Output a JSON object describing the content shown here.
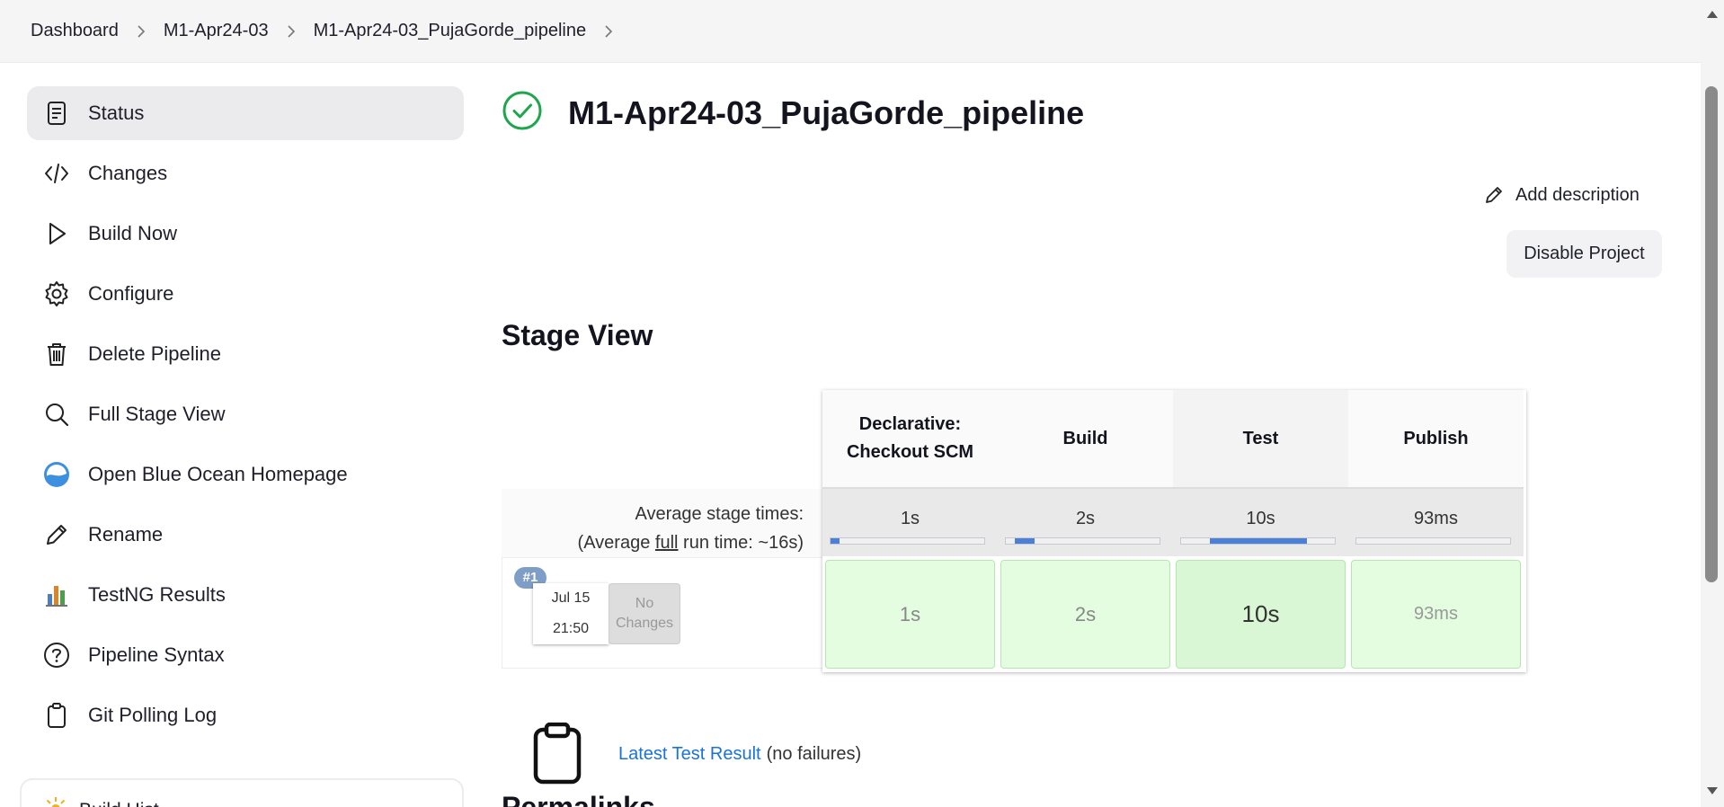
{
  "breadcrumb": {
    "items": [
      "Dashboard",
      "M1-Apr24-03",
      "M1-Apr24-03_PujaGorde_pipeline"
    ]
  },
  "sidebar": {
    "items": [
      {
        "label": "Status",
        "icon": "status-icon",
        "active": true
      },
      {
        "label": "Changes",
        "icon": "code-icon"
      },
      {
        "label": "Build Now",
        "icon": "play-icon"
      },
      {
        "label": "Configure",
        "icon": "gear-icon"
      },
      {
        "label": "Delete Pipeline",
        "icon": "trash-icon"
      },
      {
        "label": "Full Stage View",
        "icon": "search-icon"
      },
      {
        "label": "Open Blue Ocean Homepage",
        "icon": "blue-ocean-icon"
      },
      {
        "label": "Rename",
        "icon": "pencil-icon"
      },
      {
        "label": "TestNG Results",
        "icon": "chart-icon"
      },
      {
        "label": "Pipeline Syntax",
        "icon": "help-icon"
      },
      {
        "label": "Git Polling Log",
        "icon": "clipboard-icon"
      }
    ],
    "build_history": {
      "label": "Build Hist"
    }
  },
  "main": {
    "title": "M1-Apr24-03_PujaGorde_pipeline",
    "status": "success",
    "add_description": "Add description",
    "disable_project": "Disable Project",
    "stage_view_title": "Stage View",
    "avg_label_1": "Average stage times:",
    "avg_label_2_prefix": "(Average ",
    "avg_label_2_link": "full",
    "avg_label_2_suffix": " run time: ~16s)",
    "stages": [
      {
        "name_line1": "Declarative:",
        "name_line2": "Checkout SCM",
        "avg": "1s",
        "run": "1s",
        "avg_fraction": 0.06
      },
      {
        "name_line1": "Build",
        "name_line2": "",
        "avg": "2s",
        "run": "2s",
        "avg_fraction": 0.13
      },
      {
        "name_line1": "Test",
        "name_line2": "",
        "avg": "10s",
        "run": "10s",
        "avg_fraction": 0.63
      },
      {
        "name_line1": "Publish",
        "name_line2": "",
        "avg": "93ms",
        "run": "93ms",
        "avg_fraction": 0.0
      }
    ],
    "run": {
      "badge": "#1",
      "date": "Jul 15",
      "time": "21:50",
      "changes_line1": "No",
      "changes_line2": "Changes"
    },
    "test_result": {
      "link": "Latest Test Result",
      "note": "(no failures)"
    },
    "permalinks_title": "Permalinks"
  },
  "colors": {
    "success": "#1ea64b",
    "link": "#1a73d9",
    "stage_cell": "#e4fde1",
    "avg_bar": "#4a80d6"
  }
}
